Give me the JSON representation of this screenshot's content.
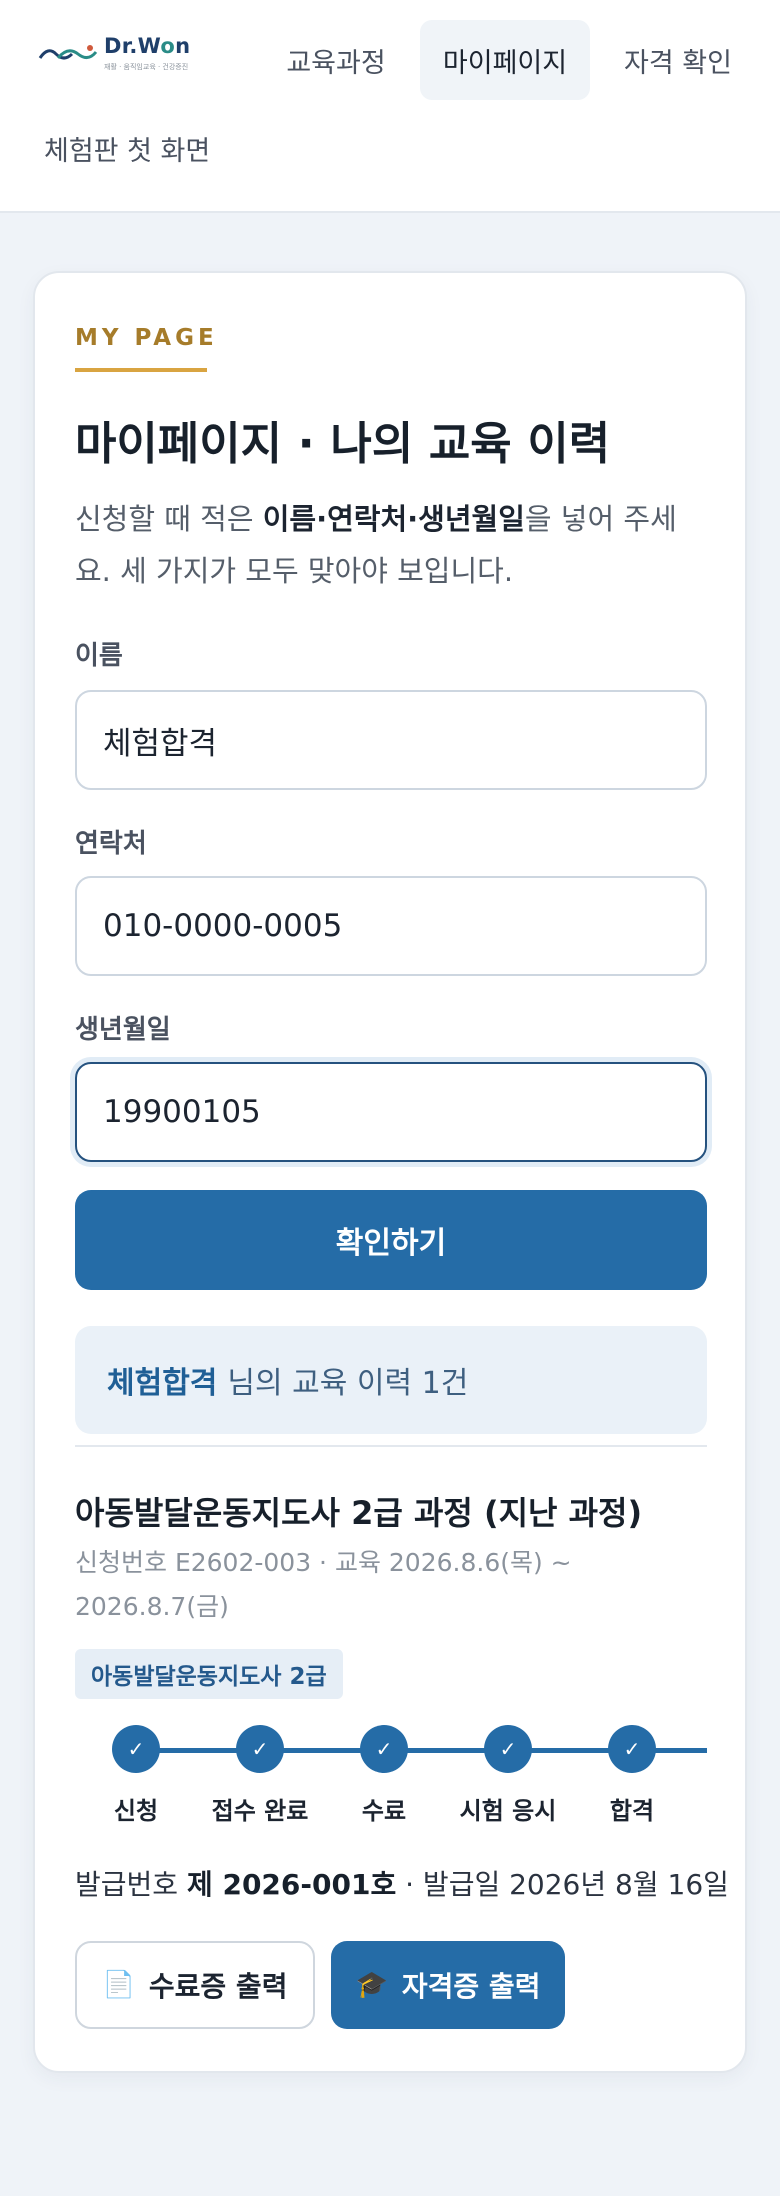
{
  "header": {
    "logo_text_1": "Dr.W",
    "logo_text_o": "o",
    "logo_text_2": "n",
    "logo_tagline": "재활 · 움직임교육 · 건강증진",
    "nav": {
      "education": "교육과정",
      "mypage": "마이페이지",
      "certificate": "자격 확인",
      "trial_home": "체험판 첫 화면"
    }
  },
  "page": {
    "kicker": "MY PAGE",
    "title": "마이페이지 · 나의 교육 이력",
    "desc_prefix": "신청할 때 적은 ",
    "desc_bold": "이름·연락처·생년월일",
    "desc_suffix": "을 넣어 주세요. 세 가지가 모두 맞아야 보입니다."
  },
  "form": {
    "name_label": "이름",
    "name_value": "체험합격",
    "phone_label": "연락처",
    "phone_value": "010-0000-0005",
    "birth_label": "생년월일",
    "birth_value": "19900105",
    "submit_label": "확인하기"
  },
  "result": {
    "user_name": "체험합격",
    "summary_text": "님의 교육 이력 1건"
  },
  "course": {
    "title": "아동발달운동지도사 2급 과정 (지난 과정)",
    "meta": "신청번호 E2602-003 · 교육 2026.8.6(목) ~ 2026.8.7(금)",
    "badge": "아동발달운동지도사 2급",
    "steps": [
      {
        "check": "✓",
        "label": "신청"
      },
      {
        "check": "✓",
        "label": "접수 완료"
      },
      {
        "check": "✓",
        "label": "수료"
      },
      {
        "check": "✓",
        "label": "시험 응시"
      },
      {
        "check": "✓",
        "label": "합격"
      }
    ],
    "issue_prefix": "발급번호 ",
    "issue_number": "제 2026-001호",
    "issue_suffix": " · 발급일 2026년 8월 16일",
    "btn_completion": "수료증 출력",
    "btn_certificate": "자격증 출력",
    "icon_completion": "📄",
    "icon_certificate": "🎓"
  },
  "colors": {
    "primary": "#256ca7",
    "accent_gold": "#d9a441",
    "kicker_text": "#a67c2a",
    "background": "#eff3f8"
  },
  "icons": {
    "logo": "wave-logo-icon",
    "check": "check-icon",
    "completion": "document-icon",
    "certificate": "graduation-cap-icon"
  }
}
